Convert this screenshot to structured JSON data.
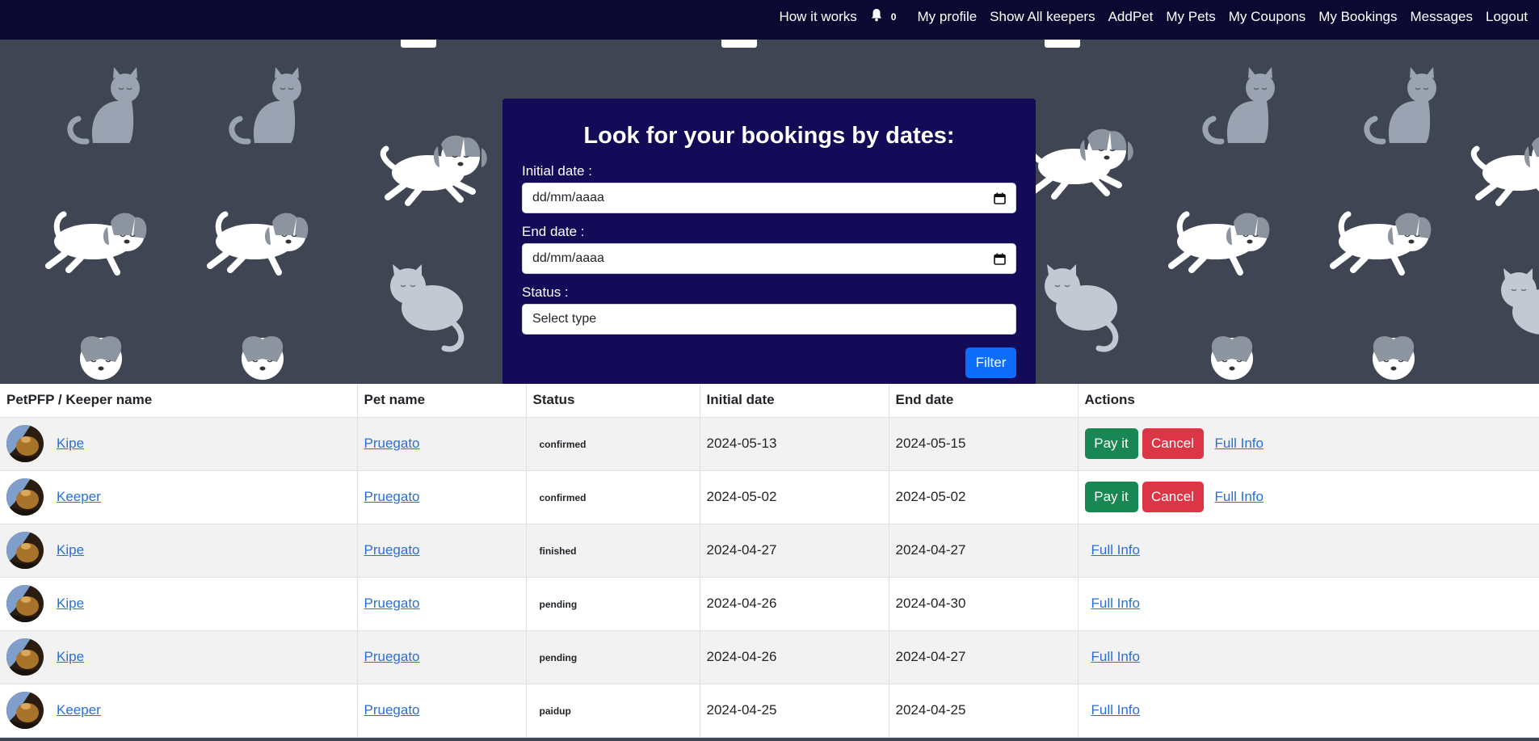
{
  "nav": {
    "items": [
      {
        "label": "How it works",
        "name": "nav-how-it-works"
      },
      {
        "label": "0",
        "name": "nav-notifications",
        "icon": "bell-icon"
      },
      {
        "label": "My profile",
        "name": "nav-my-profile"
      },
      {
        "label": "Show All keepers",
        "name": "nav-show-all-keepers"
      },
      {
        "label": "AddPet",
        "name": "nav-add-pet"
      },
      {
        "label": "My Pets",
        "name": "nav-my-pets"
      },
      {
        "label": "My Coupons",
        "name": "nav-my-coupons"
      },
      {
        "label": "My Bookings",
        "name": "nav-my-bookings"
      },
      {
        "label": "Messages",
        "name": "nav-messages"
      },
      {
        "label": "Logout",
        "name": "nav-logout"
      }
    ]
  },
  "filter": {
    "title": "Look for your bookings by dates:",
    "initial_label": "Initial date :",
    "initial_value": "dd/mm/aaaa",
    "end_label": "End date :",
    "end_value": "dd/mm/aaaa",
    "status_label": "Status :",
    "status_value": "Select type",
    "button": "Filter"
  },
  "table": {
    "headers": [
      "PetPFP / Keeper name",
      "Pet name",
      "Status",
      "Initial date",
      "End date",
      "Actions"
    ],
    "rows": [
      {
        "keeper": "Kipe",
        "pet": "Pruegato",
        "status": "confirmed",
        "start": "2024-05-13",
        "end": "2024-05-15",
        "pay": "Pay it",
        "cancel": "Cancel",
        "info": "Full Info"
      },
      {
        "keeper": "Keeper",
        "pet": "Pruegato",
        "status": "confirmed",
        "start": "2024-05-02",
        "end": "2024-05-02",
        "pay": "Pay it",
        "cancel": "Cancel",
        "info": "Full Info"
      },
      {
        "keeper": "Kipe",
        "pet": "Pruegato",
        "status": "finished",
        "start": "2024-04-27",
        "end": "2024-04-27",
        "info": "Full Info"
      },
      {
        "keeper": "Kipe",
        "pet": "Pruegato",
        "status": "pending",
        "start": "2024-04-26",
        "end": "2024-04-30",
        "info": "Full Info"
      },
      {
        "keeper": "Kipe",
        "pet": "Pruegato",
        "status": "pending",
        "start": "2024-04-26",
        "end": "2024-04-27",
        "info": "Full Info"
      },
      {
        "keeper": "Keeper",
        "pet": "Pruegato",
        "status": "paidup",
        "start": "2024-04-25",
        "end": "2024-04-25",
        "info": "Full Info"
      }
    ]
  },
  "colors": {
    "navbar": "#0b0932",
    "panel": "#130a58",
    "hero_bg": "#3f4553",
    "filter_button": "#0d6efd",
    "pay_button": "#198754",
    "cancel_button": "#dc3545",
    "link": "#2a6fd6"
  }
}
